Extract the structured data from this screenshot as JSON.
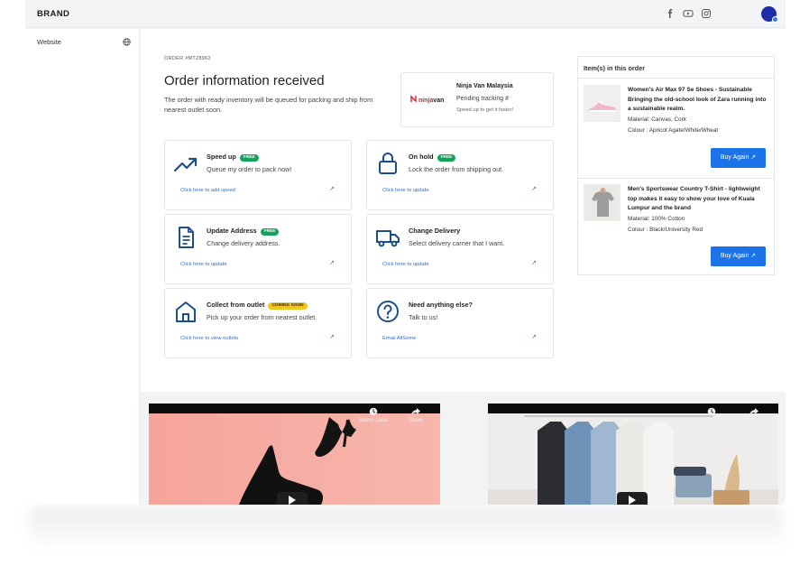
{
  "header": {
    "brand": "BRAND",
    "social": [
      "facebook-icon",
      "youtube-icon",
      "instagram-icon"
    ]
  },
  "sidebar": {
    "items": [
      {
        "label": "Website",
        "icon": "globe-icon"
      }
    ]
  },
  "order": {
    "id_label": "ORDER #MT28962",
    "title": "Order information received",
    "subtitle": "The order with ready inventory will be queued for packing and ship from nearest outlet soon."
  },
  "courier": {
    "logo_prefix": "ninja",
    "logo_suffix": "van",
    "name": "Ninja Van Malaysia",
    "status": "Pending tracking #",
    "hint": "Speed up to get it faster!"
  },
  "actions": [
    {
      "title": "Speed up",
      "badge": "FREE",
      "desc": "Queue my order to pack now!",
      "link": "Click here to add speed",
      "icon": "trend-up-icon"
    },
    {
      "title": "On hold",
      "badge": "FREE",
      "desc": "Lock the order from shipping out.",
      "link": "Click here to update",
      "icon": "lock-icon"
    },
    {
      "title": "Update Address",
      "badge": "FREE",
      "desc": "Change delivery address.",
      "link": "Click here to update",
      "icon": "document-icon"
    },
    {
      "title": "Change Delivery",
      "badge": "",
      "desc": "Select delivery carrier that I want.",
      "link": "Click here to update",
      "icon": "truck-icon"
    },
    {
      "title": "Collect from outlet",
      "badge": "COMING SOON",
      "desc": "Pick up your order from nearest outlet.",
      "link": "Click here to view outlets",
      "icon": "store-icon"
    },
    {
      "title": "Need anything else?",
      "badge": "",
      "desc": "Talk to us!",
      "link": "Email AllSome",
      "icon": "help-icon"
    }
  ],
  "items_panel": {
    "heading": "Item(s) in this order",
    "items": [
      {
        "name": "Women's Air Max 97 Se Shoes - Sustainable Bringing the old-school look of Zara running into a sustainable realm.",
        "material": "Material: Canvas, Cork",
        "colour": "Colour : Apricot Agate/White/Wheat",
        "button": "Buy Again ↗"
      },
      {
        "name": "Men's Sportswear Country T-Shirt - lightweight top makes it easy to show your love of Kuala Lumpur and the brand",
        "material": "Material: 100% Cotton",
        "colour": "Colour : Black/University Red",
        "button": "Buy Again ↗"
      }
    ]
  },
  "videos": [
    {
      "watch_later": "Watch Later",
      "share": "Share"
    },
    {
      "watch_later": "Watch Later",
      "share": "Share"
    }
  ],
  "colors": {
    "accent": "#1a73e8",
    "free_badge": "#14a35a",
    "soon_badge": "#f5c518",
    "icon": "#1b4f8a",
    "link": "#2a6fdb"
  }
}
